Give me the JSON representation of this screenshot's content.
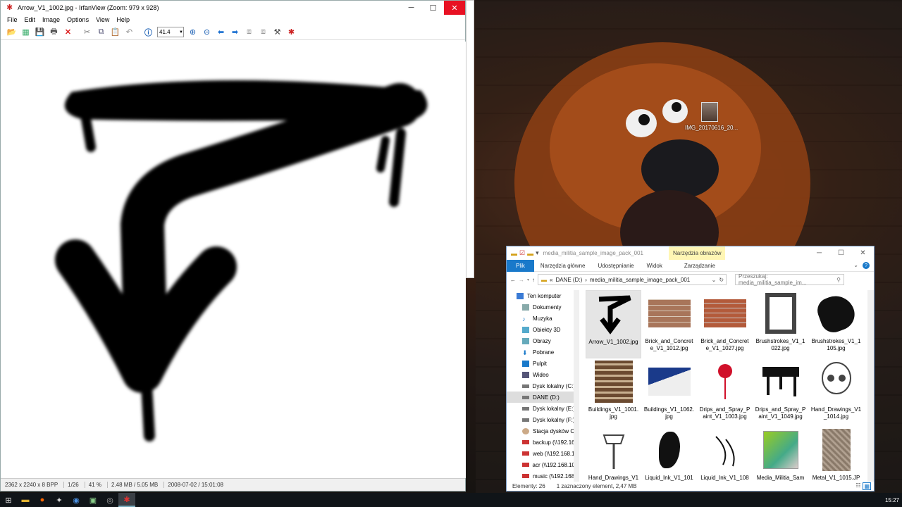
{
  "desktop": {
    "icon_label": "IMG_20170616_20..."
  },
  "irfanview": {
    "title": "Arrow_V1_1002.jpg - IrfanView (Zoom: 979 x 928)",
    "menu": [
      "File",
      "Edit",
      "Image",
      "Options",
      "View",
      "Help"
    ],
    "zoom_value": "41.4",
    "status": {
      "dimensions": "2362 x 2240 x 8 BPP",
      "index": "1/26",
      "zoom": "41 %",
      "size": "2.48 MB / 5.05 MB",
      "datetime": "2008-07-02 / 15:01:08"
    }
  },
  "explorer": {
    "title": "media_militia_sample_image_pack_001",
    "tools_tab": "Narzędzia obrazów",
    "ribbon": {
      "file": "Plik",
      "home": "Narzędzia główne",
      "share": "Udostępnianie",
      "view": "Widok",
      "manage": "Zarządzanie"
    },
    "address": {
      "prefix": "«",
      "drive": "DANE (D:)",
      "folder": "media_militia_sample_image_pack_001"
    },
    "search_placeholder": "Przeszukaj: media_militia_sample_im...",
    "nav": [
      "Ten komputer",
      "Dokumenty",
      "Muzyka",
      "Obiekty 3D",
      "Obrazy",
      "Pobrane",
      "Pulpit",
      "Wideo",
      "Dysk lokalny (C:)",
      "DANE (D:)",
      "Dysk lokalny (E:)",
      "Dysk lokalny (F:)",
      "Stacja dysków C",
      "backup (\\\\192.16",
      "web (\\\\192.168.1",
      "acr (\\\\192.168.10",
      "music (\\\\192.168"
    ],
    "files": [
      "Arrow_V1_1002.jpg",
      "Brick_and_Concrete_V1_1012.jpg",
      "Brick_and_Concrete_V1_1027.jpg",
      "Brushstrokes_V1_1022.jpg",
      "Brushstrokes_V1_1105.jpg",
      "Buildings_V1_1001.jpg",
      "Buildings_V1_1062.jpg",
      "Drips_and_Spray_Paint_V1_1003.jpg",
      "Drips_and_Spray_Paint_V1_1049.jpg",
      "Hand_Drawings_V1_1014.jpg",
      "Hand_Drawings_V1_1185.jpg",
      "Liquid_Ink_V1_1012.jpg",
      "Liquid_Ink_V1_1089.jpg",
      "Media_Militia_Sample_Image_Pac",
      "Metal_V1_1015.JPG"
    ],
    "status": {
      "count": "Elementy: 26",
      "selected": "1 zaznaczony element, 2,47 MB"
    }
  },
  "taskbar": {
    "clock": "15:27"
  }
}
